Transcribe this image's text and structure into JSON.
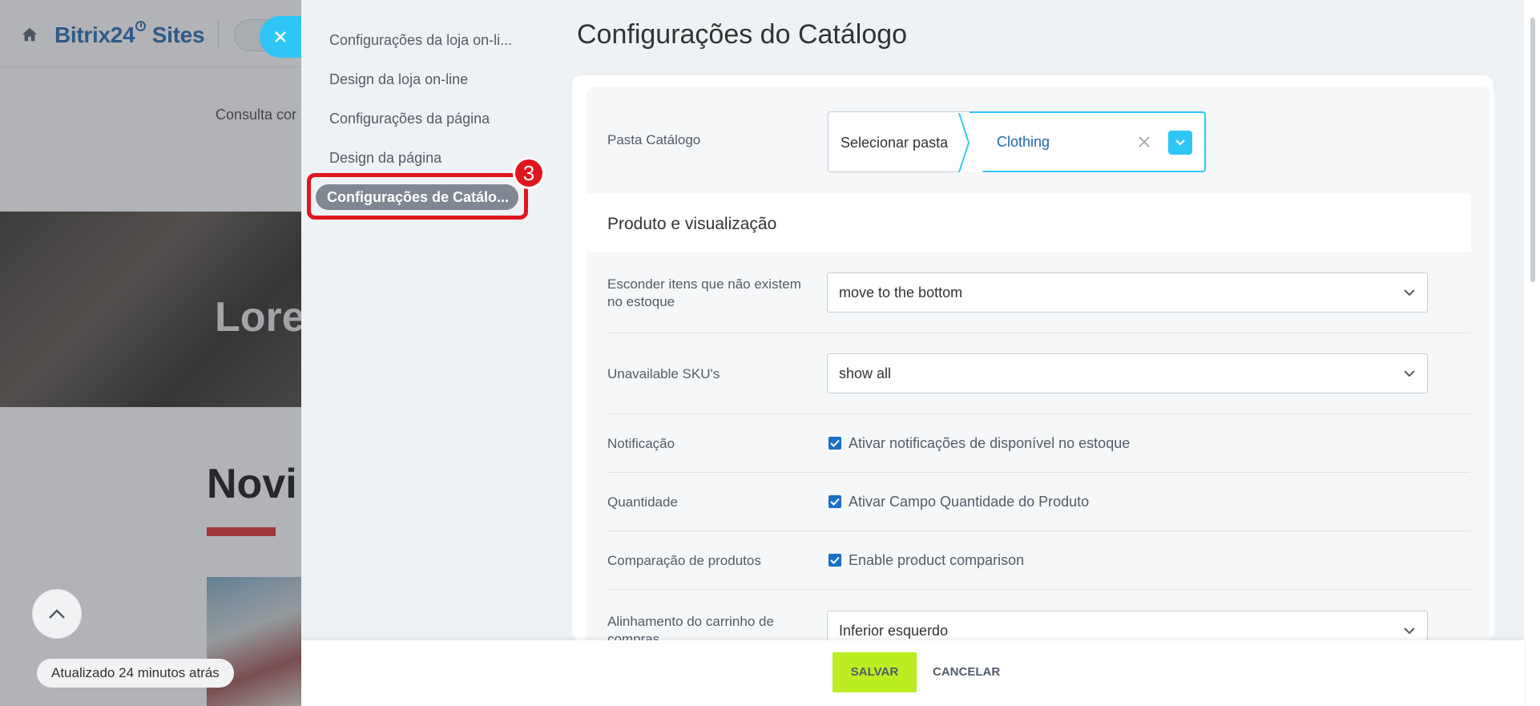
{
  "background_page": {
    "brand_part1": "Bitrix24",
    "brand_part2": " Sites",
    "consulta_text": "Consulta cor",
    "hero_text": "Lore",
    "heading_text": "Novi",
    "updated_text": "Atualizado 24 minutos atrás"
  },
  "side_menu": {
    "items": [
      {
        "label": "Configurações da loja on-li..."
      },
      {
        "label": "Design da loja on-line"
      },
      {
        "label": "Configurações da página"
      },
      {
        "label": "Design da página"
      }
    ],
    "active_label": "Configurações de Catálo...",
    "step_badge": "3"
  },
  "page_title": "Configurações do Catálogo",
  "folder": {
    "label": "Pasta Catálogo",
    "select_label": "Selecionar pasta",
    "value": "Clothing"
  },
  "section_title": "Produto e visualização",
  "fields": {
    "hide_items_label": "Esconder itens que não existem no estoque",
    "hide_items_value": "move to the bottom",
    "unavailable_sku_label": "Unavailable SKU's",
    "unavailable_sku_value": "show all",
    "notification_label": "Notificação",
    "notification_checkbox": "Ativar notificações de disponível no estoque",
    "quantity_label": "Quantidade",
    "quantity_checkbox": "Ativar Campo Quantidade do Produto",
    "comparison_label": "Comparação de produtos",
    "comparison_checkbox": "Enable product comparison",
    "cart_alignment_label": "Alinhamento do carrinho de compras",
    "cart_alignment_value": "Inferior esquerdo"
  },
  "footer": {
    "save_label": "SALVAR",
    "cancel_label": "CANCELAR"
  },
  "colors": {
    "accent": "#2fc6f6",
    "save_button": "#bbed21",
    "highlight": "#e0161e",
    "menu_active": "#7f8792"
  },
  "icons": [
    "home-icon",
    "close-icon",
    "chevron-down-icon",
    "chevron-up-icon",
    "clear-icon",
    "checkbox-checked-icon"
  ]
}
